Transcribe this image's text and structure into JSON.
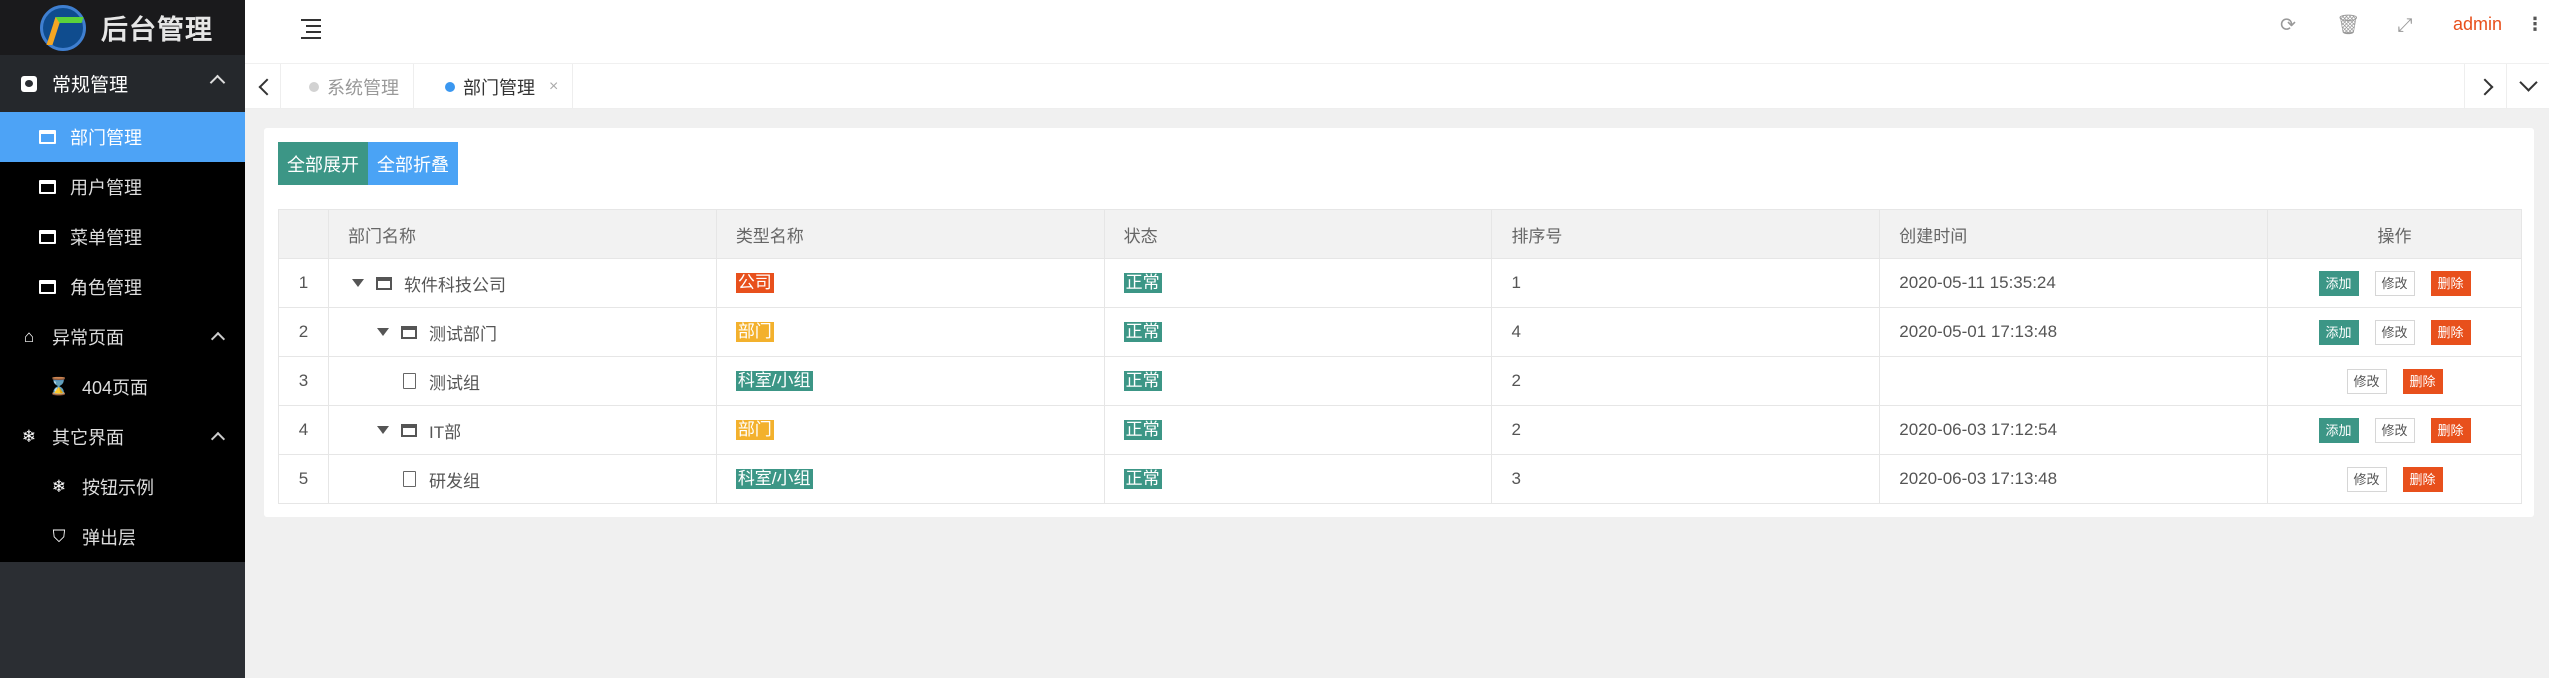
{
  "app": {
    "title": "后台管理"
  },
  "sidebar": {
    "group_label": "常规管理",
    "items": [
      {
        "label": "部门管理",
        "active": true
      },
      {
        "label": "用户管理"
      },
      {
        "label": "菜单管理"
      },
      {
        "label": "角色管理"
      }
    ],
    "error_group": {
      "label": "异常页面",
      "items": [
        {
          "label": "404页面"
        }
      ]
    },
    "other_group": {
      "label": "其它界面",
      "items": [
        {
          "label": "按钮示例"
        },
        {
          "label": "弹出层"
        }
      ]
    }
  },
  "header": {
    "user": "admin",
    "more": "⋮",
    "refresh_icon": "⟳",
    "clear_icon": "🗑",
    "fullscreen_icon": "⤢"
  },
  "tabs": [
    {
      "label": "系统管理",
      "active": false
    },
    {
      "label": "部门管理",
      "active": true,
      "close": "×"
    }
  ],
  "toolbar": {
    "expand_all": "全部展开",
    "collapse_all": "全部折叠"
  },
  "table": {
    "columns": [
      "部门名称",
      "类型名称",
      "状态",
      "排序号",
      "创建时间",
      "操作"
    ],
    "rows": [
      {
        "index": "1",
        "name": "软件科技公司",
        "type": "公司",
        "status": "正常",
        "order": "1",
        "created": "2020-05-11 15:35:24"
      },
      {
        "index": "2",
        "name": "测试部门",
        "type": "部门",
        "status": "正常",
        "order": "4",
        "created": "2020-05-01 17:13:48"
      },
      {
        "index": "3",
        "name": "测试组",
        "type": "科室/小组",
        "status": "正常",
        "order": "2",
        "created": ""
      },
      {
        "index": "4",
        "name": "IT部",
        "type": "部门",
        "status": "正常",
        "order": "2",
        "created": "2020-06-03 17:12:54"
      },
      {
        "index": "5",
        "name": "研发组",
        "type": "科室/小组",
        "status": "正常",
        "order": "3",
        "created": "2020-06-03 17:13:48"
      }
    ],
    "actions": {
      "add": "添加",
      "edit": "修改",
      "delete": "删除"
    }
  },
  "colors": {
    "accent_blue": "#4da3f6",
    "teal": "#3c9686",
    "orange_red": "#e8501c",
    "yellow": "#f3b12d",
    "sidebar_bg": "#2b2e33"
  }
}
